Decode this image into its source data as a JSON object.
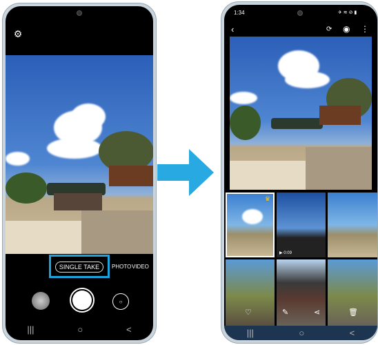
{
  "camera": {
    "settings_icon": "gear-icon",
    "modes": [
      "SINGLE TAKE",
      "PHOTO",
      "VIDEO"
    ],
    "selected_mode": "SINGLE TAKE",
    "highlight_color": "#1fa3dc",
    "nav": [
      "|||",
      "○",
      "<"
    ]
  },
  "arrow_color": "#29a9e1",
  "gallery": {
    "status_time": "1:34",
    "nav": [
      "|||",
      "○",
      "<"
    ],
    "video_duration": "0:09",
    "icons": [
      "back-icon",
      "rotate-icon",
      "eye-icon",
      "more-icon",
      "crown-icon",
      "heart-icon",
      "edit-icon",
      "share-icon",
      "trash-icon"
    ]
  }
}
